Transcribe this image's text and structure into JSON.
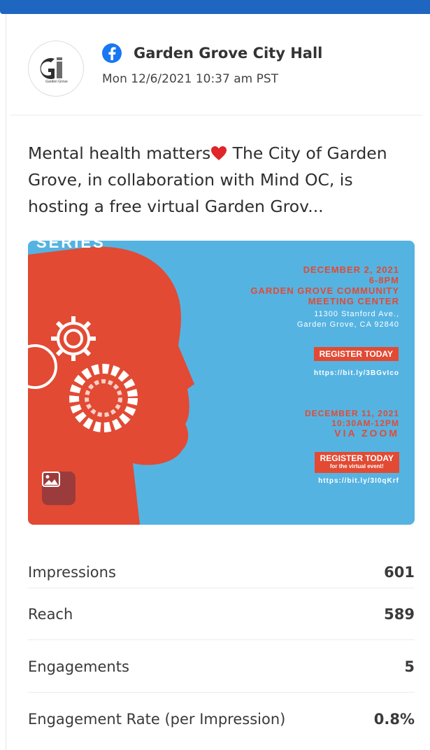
{
  "post": {
    "account_name": "Garden Grove City Hall",
    "network_icon": "facebook-icon",
    "timestamp": "Mon 12/6/2021 10:37 am PST",
    "avatar_caption": "Garden Grove",
    "text_part1": "Mental health matters",
    "text_part2": " The City of Garden Grove, in collaboration with Mind OC, is hosting a free virtual Garden Grov...",
    "heart_color": "#e0252b"
  },
  "media": {
    "series_text": "SERIES",
    "event1_date": "DECEMBER 2, 2021",
    "event1_time": "6-8PM",
    "event1_venue": "GARDEN GROVE COMMUNITY MEETING CENTER",
    "event1_address": "11300 Stanford Ave., Garden Grove, CA 92840",
    "register_label": "REGISTER TODAY",
    "event1_link": "https://bit.ly/3BGvIco",
    "event2_date": "DECEMBER 11, 2021",
    "event2_time": "10:30AM-12PM",
    "event2_place": "VIA ZOOM",
    "register2_sub": "for the virtual event!",
    "event2_link": "https://bit.ly/3I0qKrf",
    "type_icon": "image-icon",
    "background_color": "#55b3e2",
    "accent_color": "#e24a33"
  },
  "metrics": [
    {
      "label": "Impressions",
      "value": "601"
    },
    {
      "label": "Reach",
      "value": "589"
    },
    {
      "label": "Engagements",
      "value": "5"
    },
    {
      "label": "Engagement Rate (per Impression)",
      "value": "0.8%"
    }
  ]
}
